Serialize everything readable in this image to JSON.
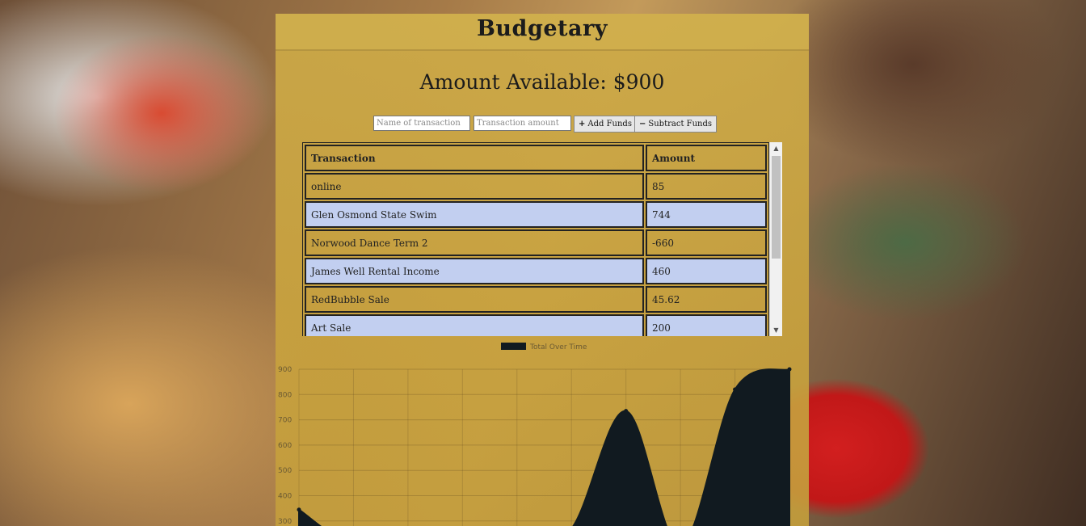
{
  "app": {
    "title": "Budgetary"
  },
  "summary": {
    "amount_text": "Amount Available: $900"
  },
  "form": {
    "name_placeholder": "Name of transaction",
    "amount_placeholder": "Transaction amount",
    "add_label": "Add Funds",
    "subtract_label": "Subtract Funds",
    "add_icon": "plus-icon",
    "subtract_icon": "minus-icon"
  },
  "table": {
    "headers": [
      "Transaction",
      "Amount"
    ],
    "rows": [
      {
        "name": "online",
        "amount": "85"
      },
      {
        "name": "Glen Osmond State Swim",
        "amount": "744"
      },
      {
        "name": "Norwood Dance Term 2",
        "amount": "-660"
      },
      {
        "name": "James Well Rental Income",
        "amount": "460"
      },
      {
        "name": "RedBubble Sale",
        "amount": "45.62"
      },
      {
        "name": "Art Sale",
        "amount": "200"
      }
    ]
  },
  "colors": {
    "row_highlight": "#c2cff0",
    "chart_fill": "#111a20",
    "panel": "#cdaa48"
  },
  "chart_data": {
    "type": "area",
    "legend": [
      {
        "name": "Total Over Time",
        "color": "#111a20"
      }
    ],
    "legend_position": "top",
    "y_ticks": [
      300,
      400,
      500,
      600,
      700,
      800,
      900
    ],
    "ylim": [
      200,
      900
    ],
    "grid": true,
    "points": [
      {
        "x": 0,
        "y": 345
      },
      {
        "x": 1,
        "y": 200
      },
      {
        "x": 2,
        "y": 200
      },
      {
        "x": 3,
        "y": 200
      },
      {
        "x": 4,
        "y": 200
      },
      {
        "x": 5,
        "y": 270
      },
      {
        "x": 6,
        "y": 735
      },
      {
        "x": 7,
        "y": 200
      },
      {
        "x": 8,
        "y": 820
      },
      {
        "x": 9,
        "y": 900
      }
    ]
  }
}
